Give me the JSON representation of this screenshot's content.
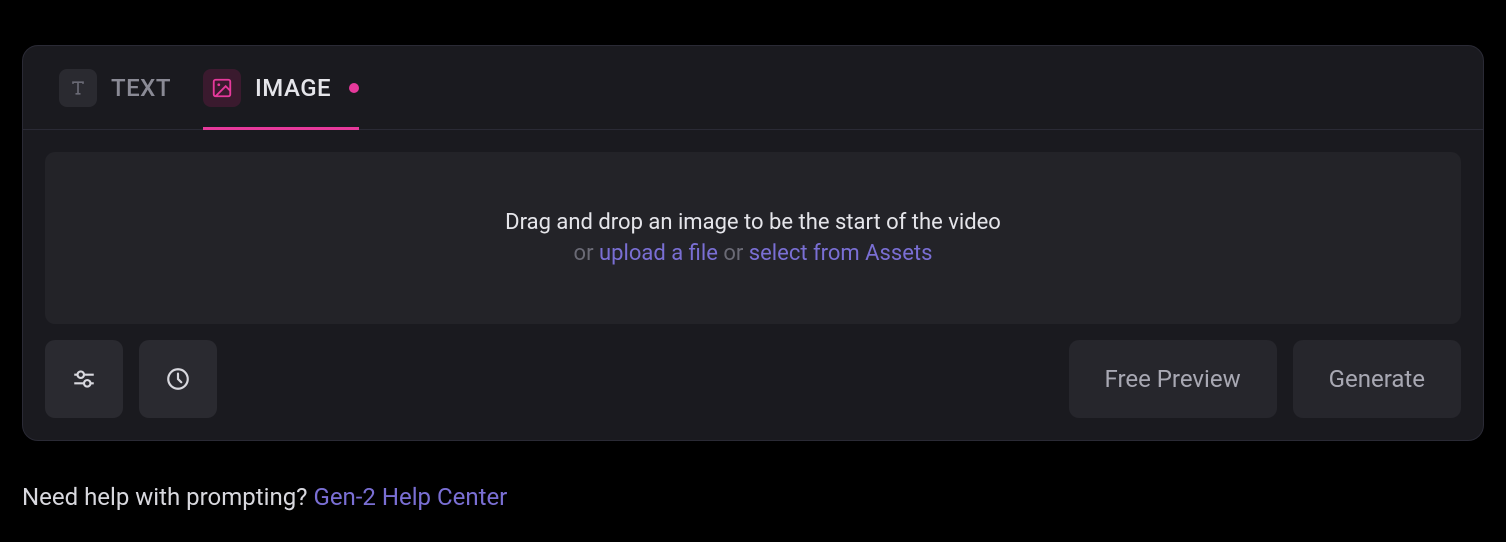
{
  "tabs": {
    "text": {
      "label": "TEXT"
    },
    "image": {
      "label": "IMAGE",
      "has_indicator": true
    }
  },
  "dropzone": {
    "main": "Drag and drop an image to be the start of the video",
    "or1": "or ",
    "upload": "upload a file",
    "or2": " or ",
    "assets": "select from Assets"
  },
  "buttons": {
    "preview": "Free Preview",
    "generate": "Generate"
  },
  "help": {
    "prefix": "Need help with prompting? ",
    "link": "Gen-2 Help Center"
  },
  "colors": {
    "accent_pink": "#e6399b",
    "link_purple": "#7a6fd4",
    "background": "#000000",
    "panel": "#1a1a1f"
  }
}
